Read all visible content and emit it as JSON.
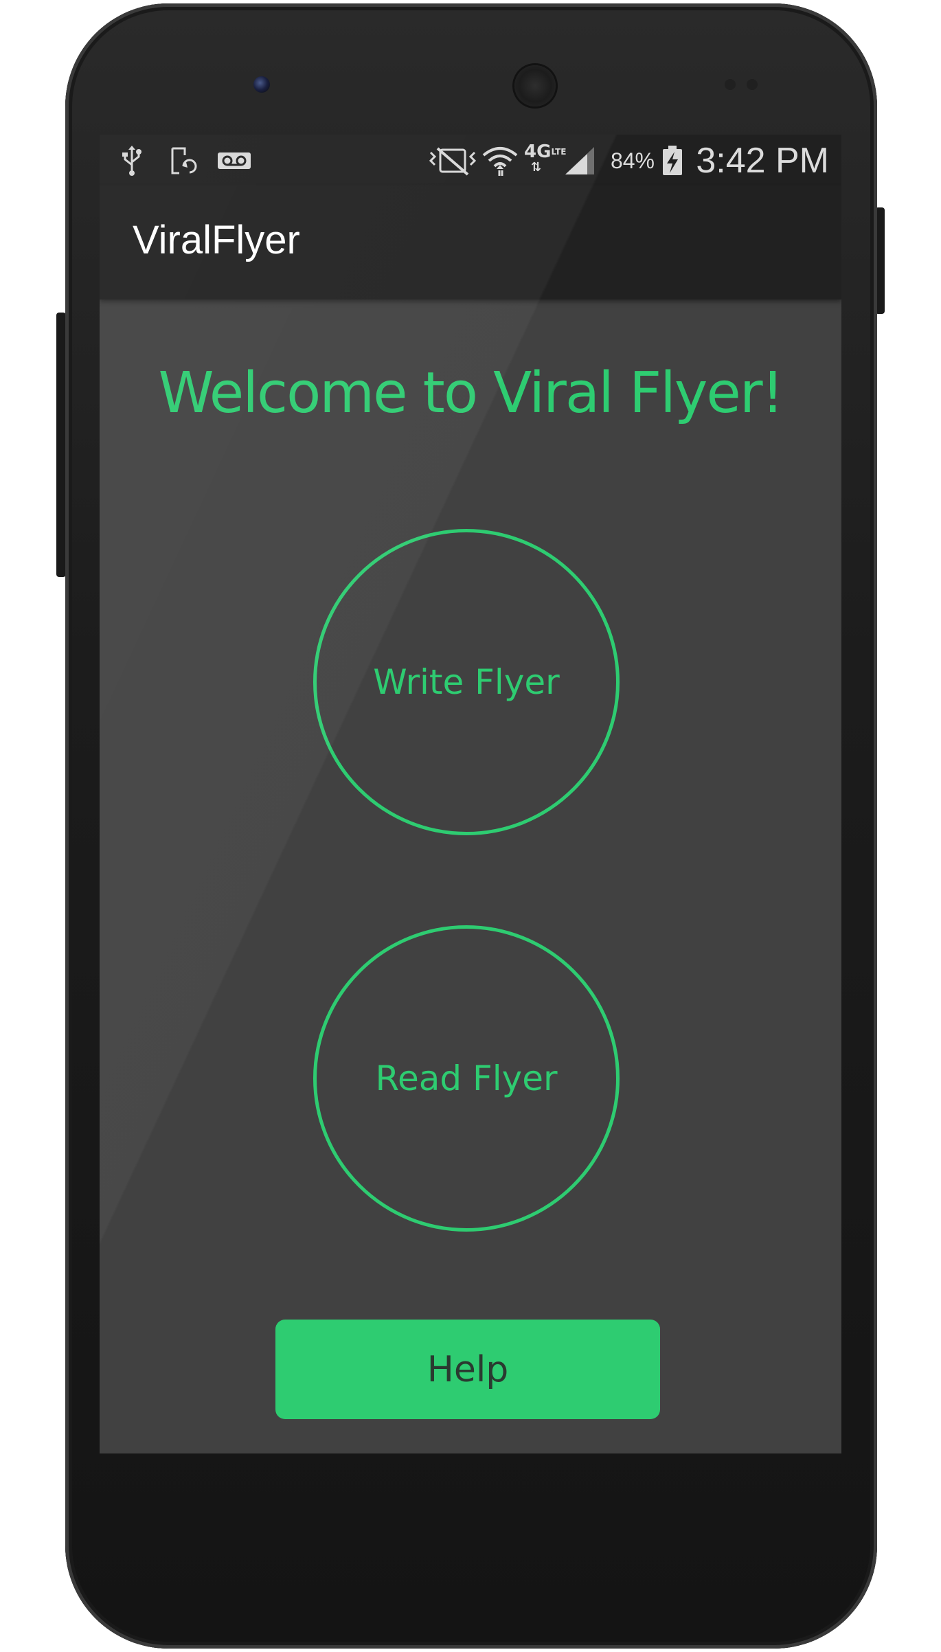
{
  "status_bar": {
    "time": "3:42 PM",
    "battery_percent": "84%",
    "network_label": "4G",
    "icons": [
      "usb-icon",
      "sync-icon",
      "voicemail-icon",
      "vibrate-icon",
      "wifi-icon",
      "lte-icon",
      "signal-icon",
      "battery-charging-icon"
    ]
  },
  "action_bar": {
    "title": "ViralFlyer"
  },
  "main": {
    "welcome": "Welcome to Viral Flyer!",
    "write_button": "Write Flyer",
    "read_button": "Read Flyer",
    "help_button": "Help"
  },
  "colors": {
    "accent": "#2ecc71",
    "screen_background": "#414141",
    "action_bar": "#212121",
    "status_bar": "#202020"
  }
}
